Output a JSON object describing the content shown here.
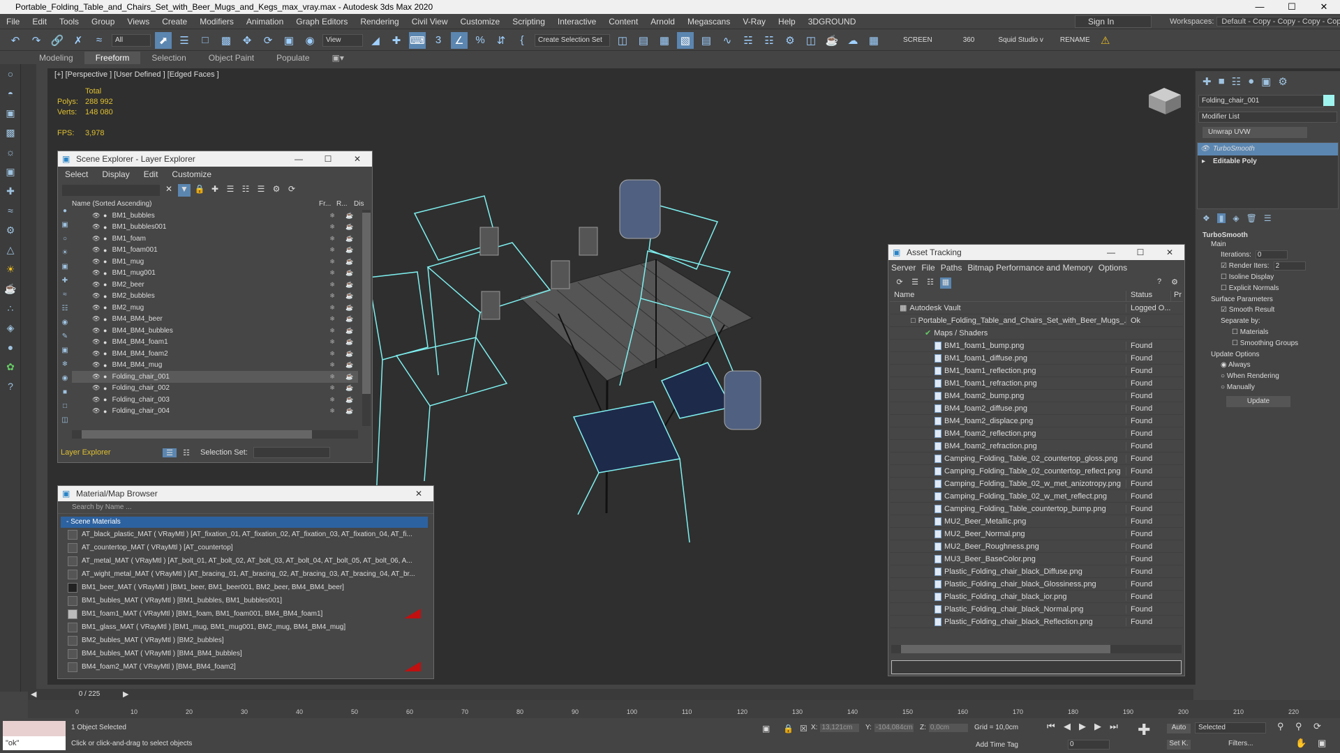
{
  "app": {
    "title": "Portable_Folding_Table_and_Chairs_Set_with_Beer_Mugs_and_Kegs_max_vray.max - Autodesk 3ds Max 2020"
  },
  "menu": [
    "File",
    "Edit",
    "Tools",
    "Group",
    "Views",
    "Create",
    "Modifiers",
    "Animation",
    "Graph Editors",
    "Rendering",
    "Civil View",
    "Customize",
    "Scripting",
    "Interactive",
    "Content",
    "Arnold",
    "Megascans",
    "V-Ray",
    "Help",
    "3DGROUND"
  ],
  "signin": "Sign In",
  "workspaces": {
    "label": "Workspaces:",
    "value": "Default - Copy - Copy - Copy - Copy"
  },
  "toolbar": {
    "filter": "All",
    "view": "View",
    "selset": "Create Selection Set",
    "screen": "SCREEN",
    "num": "360",
    "squid": "Squid Studio v",
    "rename": "RENAME"
  },
  "ribbon": [
    "Modeling",
    "Freeform",
    "Selection",
    "Object Paint",
    "Populate"
  ],
  "viewport": {
    "label": "[+] [Perspective ] [User Defined ] [Edged Faces ]",
    "total": "Total",
    "polys_label": "Polys:",
    "polys": "288 992",
    "verts_label": "Verts:",
    "verts": "148 080",
    "fps_label": "FPS:",
    "fps": "3,978"
  },
  "scene_explorer": {
    "title": "Scene Explorer - Layer Explorer",
    "menu": [
      "Select",
      "Display",
      "Edit",
      "Customize"
    ],
    "col_name": "Name (Sorted Ascending)",
    "col_fr": "Fr...",
    "col_r": "R...",
    "col_dis": "Dis",
    "rows": [
      "BM1_bubbles",
      "BM1_bubbles001",
      "BM1_foam",
      "BM1_foam001",
      "BM1_mug",
      "BM1_mug001",
      "BM2_beer",
      "BM2_bubbles",
      "BM2_mug",
      "BM4_BM4_beer",
      "BM4_BM4_bubbles",
      "BM4_BM4_foam1",
      "BM4_BM4_foam2",
      "BM4_BM4_mug",
      "Folding_chair_001",
      "Folding_chair_002",
      "Folding_chair_003",
      "Folding_chair_004"
    ],
    "footer_layer": "Layer Explorer",
    "footer_selset": "Selection Set:"
  },
  "material_browser": {
    "title": "Material/Map Browser",
    "search": "Search by Name ...",
    "group": "- Scene Materials",
    "rows": [
      "AT_black_plastic_MAT  ( VRayMtl )  [AT_fixation_01, AT_fixation_02, AT_fixation_03, AT_fixation_04, AT_fi...",
      "AT_countertop_MAT  ( VRayMtl )  [AT_countertop]",
      "AT_metal_MAT  ( VRayMtl )  [AT_bolt_01, AT_bolt_02, AT_bolt_03, AT_bolt_04, AT_bolt_05, AT_bolt_06, A...",
      "AT_wight_metal_MAT  ( VRayMtl )  [AT_bracing_01, AT_bracing_02, AT_bracing_03, AT_bracing_04, AT_br...",
      "BM1_beer_MAT  ( VRayMtl )  [BM1_beer, BM1_beer001, BM2_beer, BM4_BM4_beer]",
      "BM1_bubles_MAT  ( VRayMtl )  [BM1_bubbles, BM1_bubbles001]",
      "BM1_foam1_MAT  ( VRayMtl )  [BM1_foam, BM1_foam001, BM4_BM4_foam1]",
      "BM1_glass_MAT  ( VRayMtl )  [BM1_mug, BM1_mug001, BM2_mug, BM4_BM4_mug]",
      "BM2_bubles_MAT  ( VRayMtl )  [BM2_bubbles]",
      "BM4_bubles_MAT  ( VRayMtl )  [BM4_BM4_bubbles]",
      "BM4_foam2_MAT  ( VRayMtl )  [BM4_BM4_foam2]"
    ]
  },
  "asset_tracking": {
    "title": "Asset Tracking",
    "menu": [
      "Server",
      "File",
      "Paths",
      "Bitmap Performance and Memory",
      "Options"
    ],
    "col_name": "Name",
    "col_status": "Status",
    "col_pr": "Pr",
    "vault": "Autodesk Vault",
    "vault_status": "Logged O...",
    "file": "Portable_Folding_Table_and_Chairs_Set_with_Beer_Mugs_...",
    "file_status": "Ok",
    "maps": "Maps / Shaders",
    "items": [
      "BM1_foam1_bump.png",
      "BM1_foam1_diffuse.png",
      "BM1_foam1_reflection.png",
      "BM1_foam1_refraction.png",
      "BM4_foam2_bump.png",
      "BM4_foam2_diffuse.png",
      "BM4_foam2_displace.png",
      "BM4_foam2_reflection.png",
      "BM4_foam2_refraction.png",
      "Camping_Folding_Table_02_countertop_gloss.png",
      "Camping_Folding_Table_02_countertop_reflect.png",
      "Camping_Folding_Table_02_w_met_anizotropy.png",
      "Camping_Folding_Table_02_w_met_reflect.png",
      "Camping_Folding_Table_countertop_bump.png",
      "MU2_Beer_Metallic.png",
      "MU2_Beer_Normal.png",
      "MU2_Beer_Roughness.png",
      "MU3_Beer_BaseColor.png",
      "Plastic_Folding_chair_black_Diffuse.png",
      "Plastic_Folding_chair_black_Glossiness.png",
      "Plastic_Folding_chair_black_ior.png",
      "Plastic_Folding_chair_black_Normal.png",
      "Plastic_Folding_chair_black_Reflection.png"
    ],
    "found": "Found"
  },
  "command_panel": {
    "object_name": "Folding_chair_001",
    "modifier_list": "Modifier List",
    "unwrap": "Unwrap UVW",
    "stack": [
      "TurboSmooth",
      "Editable Poly"
    ],
    "turbosmooth": "TurboSmooth",
    "main": "Main",
    "iterations_label": "Iterations:",
    "iterations": "0",
    "render_iters_label": "Render Iters:",
    "render_iters": "2",
    "isoline": "Isoline Display",
    "explicit": "Explicit Normals",
    "surface": "Surface Parameters",
    "smooth": "Smooth Result",
    "separate": "Separate by:",
    "materials": "Materials",
    "smoothing": "Smoothing Groups",
    "update_opts": "Update Options",
    "always": "Always",
    "when_rendering": "When Rendering",
    "manually": "Manually",
    "update": "Update"
  },
  "timeline": {
    "frame": "0 / 225",
    "ticks": [
      "0",
      "10",
      "20",
      "30",
      "40",
      "50",
      "60",
      "70",
      "80",
      "90",
      "100",
      "110",
      "120",
      "130",
      "140",
      "150",
      "160",
      "170",
      "180",
      "190",
      "200",
      "210",
      "220"
    ]
  },
  "status": {
    "maxscript": "\"ok\"",
    "selected": "1 Object Selected",
    "hint": "Click or click-and-drag to select objects",
    "x_label": "X:",
    "x": "13,121cm",
    "y_label": "Y:",
    "y": "-104,084cm",
    "z_label": "Z:",
    "z": "0,0cm",
    "grid": "Grid = 10,0cm",
    "addtag": "Add Time Tag",
    "auto": "Auto",
    "setk": "Set K.",
    "sel_dd": "Selected",
    "filters": "Filters...",
    "frame_box": "0"
  }
}
